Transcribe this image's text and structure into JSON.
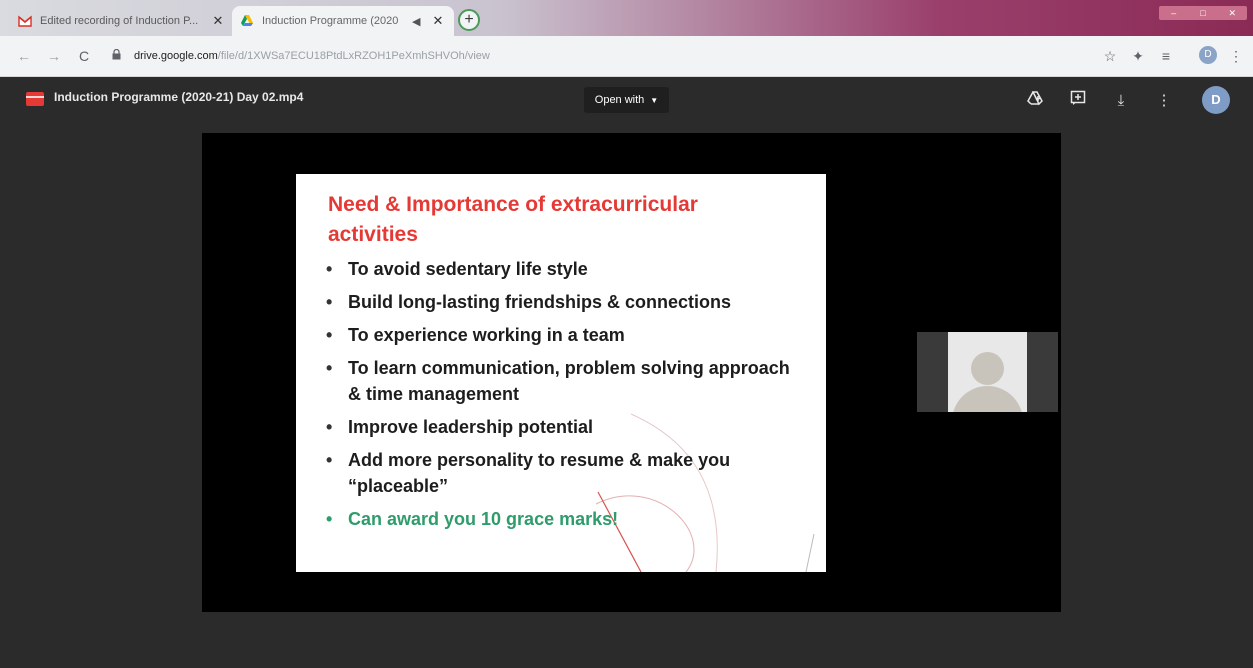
{
  "browser": {
    "tabs": [
      {
        "title": "Edited recording of Induction P...",
        "close": "✕",
        "active": false
      },
      {
        "title": "Induction Programme (2020",
        "close": "✕",
        "speaker": "◀",
        "active": true
      }
    ],
    "new_tab": "+",
    "url_domain": "drive.google.com",
    "url_path": "/file/d/1XWSa7ECU18PtdLxRZOH1PeXmhSHVOh/view",
    "profile_initial": "D"
  },
  "viewer": {
    "file_name": "Induction Programme (2020-21) Day 02.mp4",
    "open_with_label": "Open with",
    "avatar_initial": "D"
  },
  "slide": {
    "title": "Need & Importance of extracurricular activities",
    "bullets": [
      "To avoid sedentary life style",
      "Build long-lasting friendships & connections",
      "To experience working in a team",
      "To learn communication, problem solving approach & time management",
      "Improve leadership potential",
      "Add more personality to resume & make you “placeable”",
      "Can award you 10 grace marks!"
    ],
    "colors": {
      "title": "#e53935",
      "highlight": "#2e9c6b",
      "text": "#1d1d1d"
    }
  },
  "icons": {
    "back": "←",
    "forward": "→",
    "reload": "C",
    "lock": "🔒",
    "star": "☆",
    "extension": "✦",
    "queue": "≡",
    "menu": "⋮",
    "add_to_drive": "▲",
    "comment": "⊞",
    "download": "⤓",
    "more": "⋮"
  }
}
